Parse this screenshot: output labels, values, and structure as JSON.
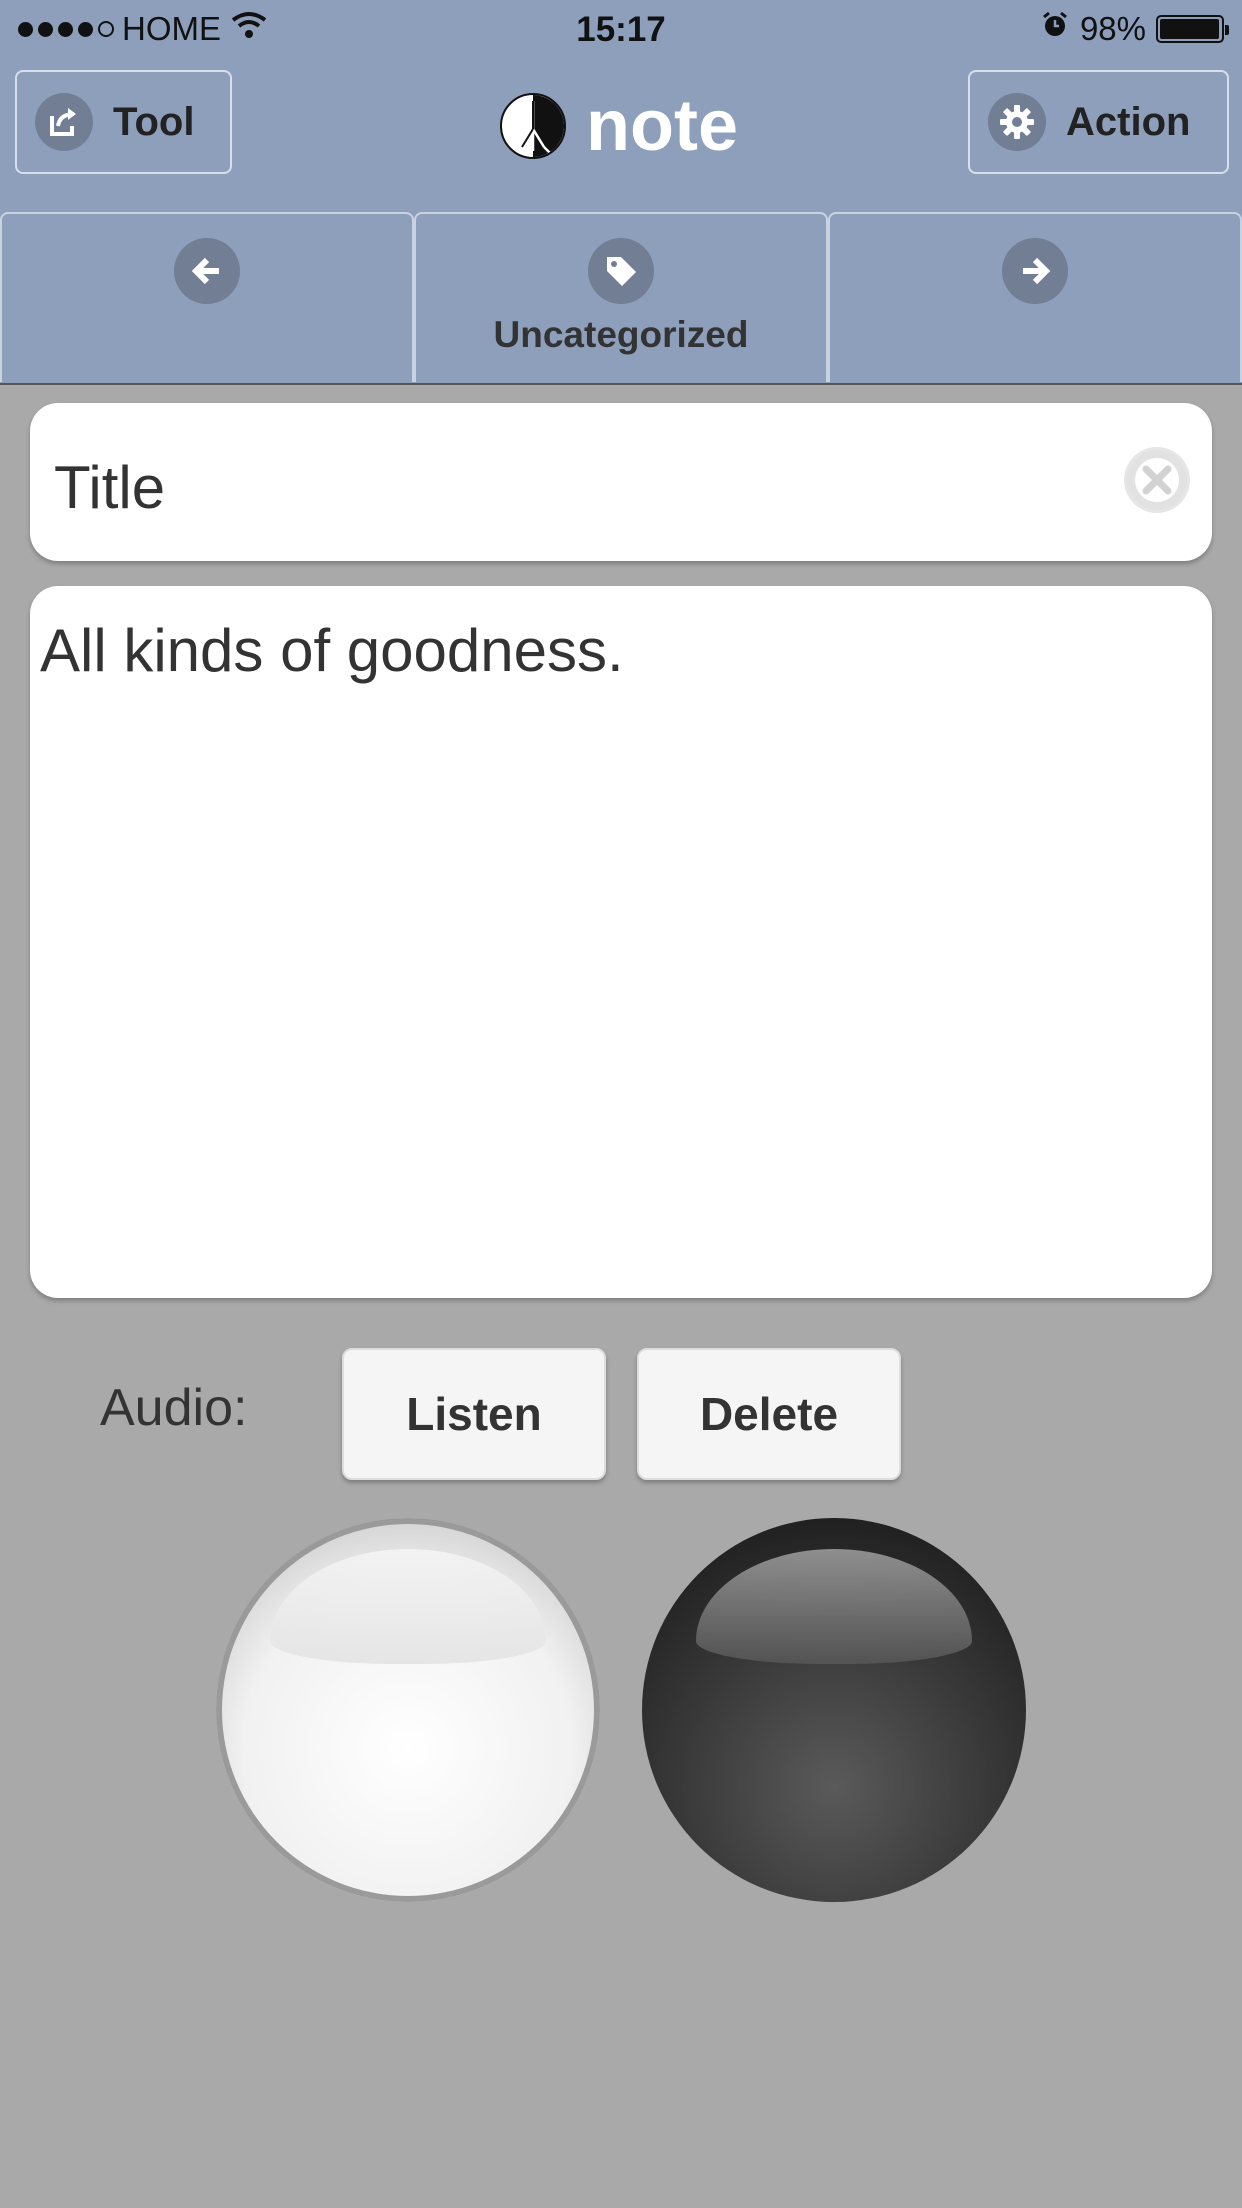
{
  "status_bar": {
    "carrier": "HOME",
    "time": "15:17",
    "battery": "98%",
    "battery_level": 0.98,
    "icons": [
      "signal-dots-icon",
      "wifi-icon",
      "alarm-icon",
      "battery-icon"
    ]
  },
  "header": {
    "tool_label": "Tool",
    "title": "note",
    "action_label": "Action"
  },
  "nav_tabs": {
    "prev_icon": "arrow-left-icon",
    "category_label": "Uncategorized",
    "category_icon": "tag-icon",
    "next_icon": "arrow-right-icon"
  },
  "note": {
    "title_value": "Title",
    "body_value": "All kinds of goodness."
  },
  "audio": {
    "label": "Audio:",
    "listen_label": "Listen",
    "delete_label": "Delete"
  },
  "colors": {
    "header_bg": "#8e9fbb",
    "icon_circle": "#717e94",
    "page_bg": "#a9a9a9"
  }
}
